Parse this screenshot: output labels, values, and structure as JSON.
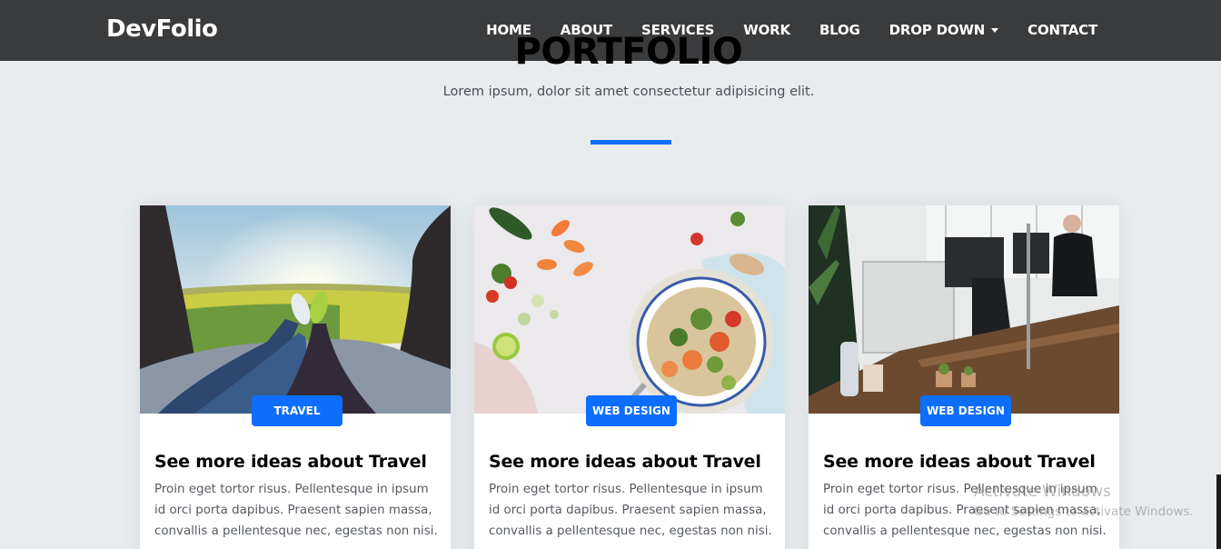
{
  "navbar": {
    "brand": "DevFolio",
    "links": [
      {
        "label": "HOME"
      },
      {
        "label": "ABOUT"
      },
      {
        "label": "SERVICES"
      },
      {
        "label": "WORK"
      },
      {
        "label": "BLOG"
      },
      {
        "label": "DROP DOWN",
        "has_dropdown": true,
        "icon": "chevron-down-icon"
      },
      {
        "label": "CONTACT"
      }
    ]
  },
  "section": {
    "title": "PORTFOLIO",
    "subtitle": "Lorem ipsum, dolor sit amet consectetur adipisicing elit.",
    "accent_color": "#0d6efd"
  },
  "cards": [
    {
      "category": "TRAVEL",
      "image": "travel-photo",
      "title": "See more ideas about Travel",
      "text": "Proin eget tortor risus. Pellentesque in ipsum id orci porta dapibus. Praesent sapien massa, convallis a pellentesque nec, egestas non nisi."
    },
    {
      "category": "WEB DESIGN",
      "image": "food-photo",
      "title": "See more ideas about Travel",
      "text": "Proin eget tortor risus. Pellentesque in ipsum id orci porta dapibus. Praesent sapien massa, convallis a pellentesque nec, egestas non nisi."
    },
    {
      "category": "WEB DESIGN",
      "image": "office-photo",
      "title": "See more ideas about Travel",
      "text": "Proin eget tortor risus. Pellentesque in ipsum id orci porta dapibus. Praesent sapien massa, convallis a pellentesque nec, egestas non nisi."
    }
  ],
  "watermark": {
    "line1": "Activate Windows",
    "line2": "Go to Settings to activate Windows."
  },
  "colors": {
    "navbar_bg": "#3a3b3d",
    "page_bg": "#e9ecef",
    "badge_bg": "#0d6efd"
  }
}
